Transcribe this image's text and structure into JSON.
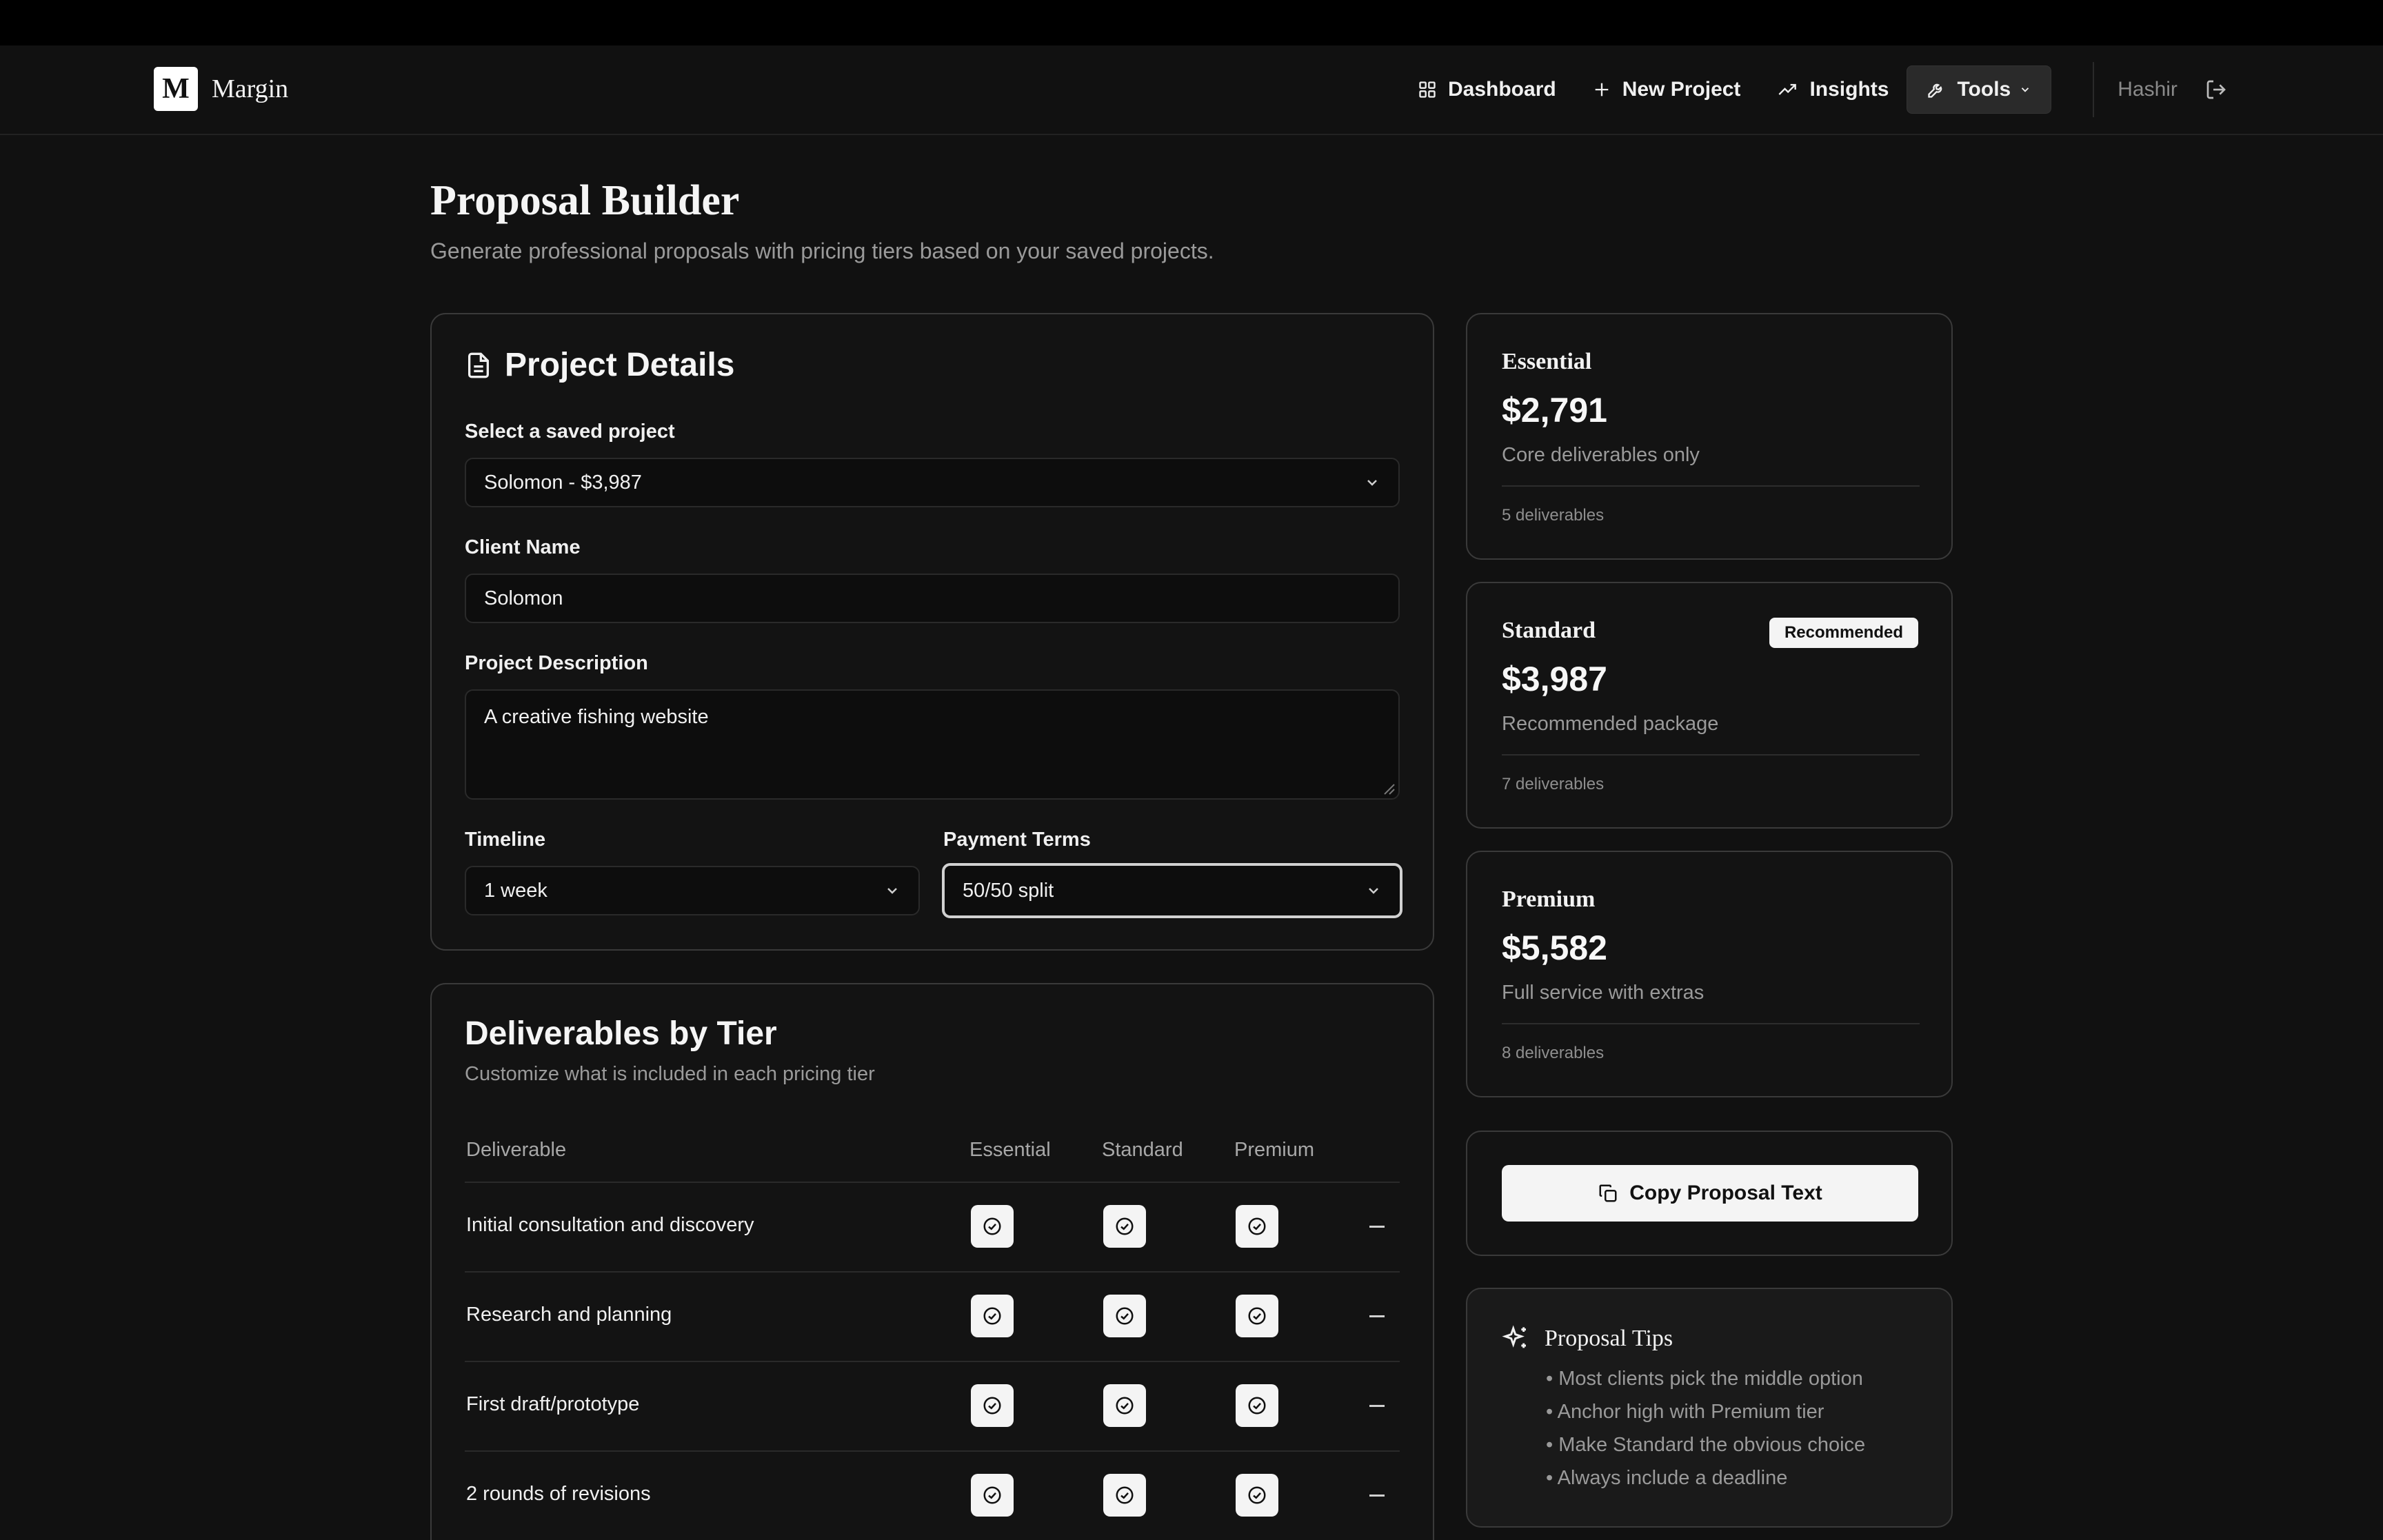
{
  "brand": {
    "logo_letter": "M",
    "name": "Margin"
  },
  "nav": {
    "dashboard": "Dashboard",
    "new_project": "New Project",
    "insights": "Insights",
    "tools": "Tools",
    "user": "Hashir"
  },
  "page": {
    "title": "Proposal Builder",
    "subtitle": "Generate professional proposals with pricing tiers based on your saved projects."
  },
  "project_details": {
    "title": "Project Details",
    "select_label": "Select a saved project",
    "select_value": "Solomon - $3,987",
    "client_label": "Client Name",
    "client_value": "Solomon",
    "desc_label": "Project Description",
    "desc_value": "A creative fishing website",
    "timeline_label": "Timeline",
    "timeline_value": "1 week",
    "payment_label": "Payment Terms",
    "payment_value": "50/50 split"
  },
  "deliverables": {
    "title": "Deliverables by Tier",
    "subtitle": "Customize what is included in each pricing tier",
    "headers": {
      "deliverable": "Deliverable",
      "essential": "Essential",
      "standard": "Standard",
      "premium": "Premium"
    },
    "rows": [
      {
        "label": "Initial consultation and discovery",
        "essential": true,
        "standard": true,
        "premium": true
      },
      {
        "label": "Research and planning",
        "essential": true,
        "standard": true,
        "premium": true
      },
      {
        "label": "First draft/prototype",
        "essential": true,
        "standard": true,
        "premium": true
      },
      {
        "label": "2 rounds of revisions",
        "essential": true,
        "standard": true,
        "premium": true
      }
    ]
  },
  "tiers": [
    {
      "name": "Essential",
      "price": "$2,791",
      "desc": "Core deliverables only",
      "count": "5 deliverables",
      "badge": ""
    },
    {
      "name": "Standard",
      "price": "$3,987",
      "desc": "Recommended package",
      "count": "7 deliverables",
      "badge": "Recommended"
    },
    {
      "name": "Premium",
      "price": "$5,582",
      "desc": "Full service with extras",
      "count": "8 deliverables",
      "badge": ""
    }
  ],
  "copy_button": "Copy Proposal Text",
  "tips": {
    "title": "Proposal Tips",
    "items": [
      "• Most clients pick the middle option",
      "• Anchor high with Premium tier",
      "• Make Standard the obvious choice",
      "• Always include a deadline"
    ]
  },
  "icons": {
    "dashboard": "grid-icon",
    "new_project": "plus-icon",
    "insights": "trending-up-icon",
    "tools": "wrench-icon",
    "logout": "logout-icon",
    "document": "document-icon",
    "check": "check-circle-icon",
    "copy": "copy-icon",
    "sparkle": "sparkles-icon"
  }
}
